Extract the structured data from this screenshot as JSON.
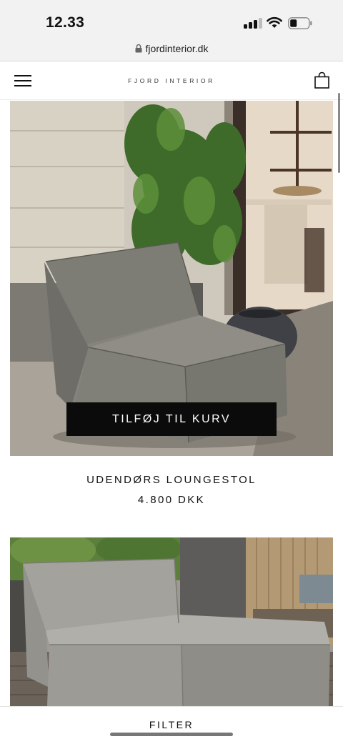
{
  "status_bar": {
    "time": "12.33"
  },
  "browser": {
    "url": "fjordinterior.dk"
  },
  "header": {
    "brand": "FJORD INTERIOR"
  },
  "products": [
    {
      "name": "UDENDØRS LOUNGESTOL",
      "price": "4.800 DKK",
      "add_to_cart_label": "TILFØJ TIL KURV"
    },
    {
      "name": "",
      "price": ""
    }
  ],
  "filter_bar": {
    "label": "FILTER"
  },
  "icons": [
    "lock-icon",
    "menu-icon",
    "cart-icon",
    "signal-icon",
    "wifi-icon",
    "battery-icon"
  ],
  "colors": {
    "button_bg": "#0b0b0b",
    "button_text": "#ffffff",
    "status_bar_bg": "#f2f2f2"
  }
}
